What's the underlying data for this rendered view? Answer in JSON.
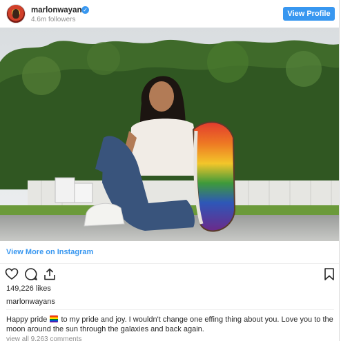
{
  "header": {
    "username": "marlonwayans",
    "followers": "4.6m followers",
    "view_profile_label": "View Profile"
  },
  "icons": {
    "avatar": "avatar",
    "verified": "verified-badge-icon",
    "like": "heart-icon",
    "comment": "comment-icon",
    "share": "share-icon",
    "save": "bookmark-icon",
    "emoji": "rainbow-emoji"
  },
  "view_more": {
    "label": "View More on Instagram"
  },
  "engagement": {
    "likes": "149,226 likes"
  },
  "caption": {
    "username": "marlonwayans",
    "text_before_emoji": "Happy pride",
    "text_after_emoji": "to my pride and joy. I wouldn't change one effing thing about you. Love you to the moon around the sun through the galaxies and back again.",
    "view_comments": "view all 9,263 comments"
  },
  "colors": {
    "accent": "#3897f0",
    "text": "#262626",
    "muted": "#8e8e8e"
  }
}
